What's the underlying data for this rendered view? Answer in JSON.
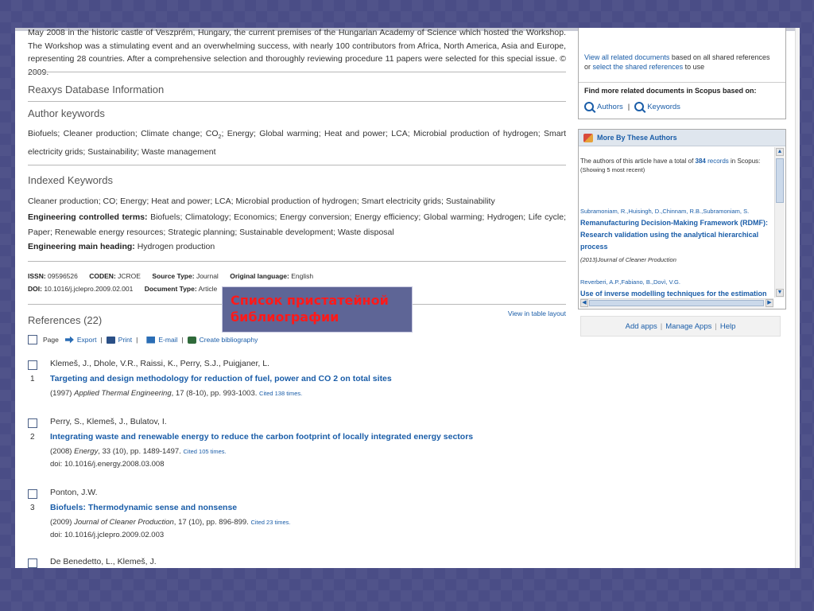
{
  "abstract": {
    "clipped_line": "May 2008 in the historic castle of Veszprém, Hungary, the current premises of the Hungarian Academy of Science which hosted the Workshop. The",
    "text": "Workshop was a stimulating event and an overwhelming success, with nearly 100 contributors from Africa, North America, Asia and Europe, representing 28 countries. After a comprehensive selection and thoroughly reviewing procedure 11 papers were selected for this special issue. © 2009."
  },
  "reaxys": {
    "title": "Reaxys Database Information"
  },
  "author_keywords": {
    "title": "Author keywords",
    "text_a": "Biofuels; Cleaner production; Climate change; CO",
    "sub": "2",
    "text_b": "; Energy; Global warming; Heat and power; LCA; Microbial production of hydrogen; Smart electricity grids; Sustainability; Waste management"
  },
  "indexed_keywords": {
    "title": "Indexed Keywords",
    "line1": "Cleaner production; CO; Energy; Heat and power; LCA; Microbial production of hydrogen; Smart electricity grids; Sustainability",
    "eng_controlled_label": "Engineering controlled terms:",
    "eng_controlled": "Biofuels; Climatology; Economics; Energy conversion; Energy efficiency; Global warming; Hydrogen; Life cycle; Paper; Renewable energy resources; Strategic planning; Sustainable development; Waste disposal",
    "eng_main_label": "Engineering main heading:",
    "eng_main": "Hydrogen production"
  },
  "meta": {
    "issn_label": "ISSN:",
    "issn": "09596526",
    "coden_label": "CODEN:",
    "coden": "JCROE",
    "source_type_label": "Source Type:",
    "source_type": "Journal",
    "lang_label": "Original language:",
    "lang": "English",
    "doi_label": "DOI:",
    "doi": "10.1016/j.jclepro.2009.02.001",
    "doctype_label": "Document Type:",
    "doctype": "Article"
  },
  "callout": {
    "line1": "Список пристатейной",
    "line2": "библиографии"
  },
  "references": {
    "title": "References (22)",
    "view_table": "View in table layout",
    "toolbar": {
      "page": "Page",
      "export": "Export",
      "print": "Print",
      "email": "E-mail",
      "bibliography": "Create bibliography",
      "sep": "|"
    },
    "items": [
      {
        "num": "1",
        "authors": "Klemeš, J., Dhole, V.R., Raissi, K., Perry, S.J., Puigjaner, L.",
        "title": "Targeting and design methodology for reduction of fuel, power and CO 2 on total sites",
        "src_year": "(1997)",
        "src_journal": "Applied Thermal Engineering",
        "src_rest": ", 17 (8-10), pp. 993-1003.",
        "cited": "Cited 138 times.",
        "doi": ""
      },
      {
        "num": "2",
        "authors": "Perry, S., Klemeš, J., Bulatov, I.",
        "title": "Integrating waste and renewable energy to reduce the carbon footprint of locally integrated energy sectors",
        "src_year": "(2008)",
        "src_journal": "Energy",
        "src_rest": ", 33 (10), pp. 1489-1497.",
        "cited": "Cited 105 times.",
        "doi": "doi: 10.1016/j.energy.2008.03.008"
      },
      {
        "num": "3",
        "authors": "Ponton, J.W.",
        "title": "Biofuels: Thermodynamic sense and nonsense",
        "src_year": "(2009)",
        "src_journal": "Journal of Cleaner Production",
        "src_rest": ", 17 (10), pp. 896-899.",
        "cited": "Cited 23 times.",
        "doi": "doi: 10.1016/j.jclepro.2009.02.003"
      },
      {
        "num": "",
        "authors": "De Benedetto, L., Klemeš, J.",
        "title": "",
        "src_year": "",
        "src_journal": "",
        "src_rest": "",
        "cited": "",
        "doi": ""
      }
    ]
  },
  "sidebar": {
    "related": {
      "link1": "View all related documents",
      "text1": " based on all shared references or ",
      "link2": "select the shared references",
      "text2": " to use",
      "find_more": "Find more related documents in Scopus based on:",
      "authors": "Authors",
      "sep": "|",
      "keywords": "Keywords"
    },
    "more_by_authors": {
      "title": "More By These Authors",
      "intro_a": "The authors of this article have a total of ",
      "intro_count": "384",
      "intro_link": " records",
      "intro_b": " in Scopus:",
      "showing": "(Showing 5 most recent)",
      "pubs": [
        {
          "authors": "Subramoniam, R.,Huisingh, D.,Chinnam, R.B.,Subramoniam, S.",
          "title": "Remanufacturing Decision-Making Framework (RDMF): Research validation using the analytical hierarchical process",
          "source": "(2013)Journal of Cleaner Production"
        },
        {
          "authors": "Reverberi, A.P.,Fabiano, B.,Dovì, V.G.",
          "title": "Use of inverse modelling techniques for the estimation",
          "source": ""
        }
      ]
    },
    "apps_bar": {
      "add": "Add apps",
      "manage": "Manage Apps",
      "help": "Help",
      "sep": "|"
    }
  },
  "colors": {
    "background": "#4a4d86",
    "link": "#1a5da8",
    "callout_bg": "#5e6596",
    "callout_text": "#ff1a1a"
  }
}
